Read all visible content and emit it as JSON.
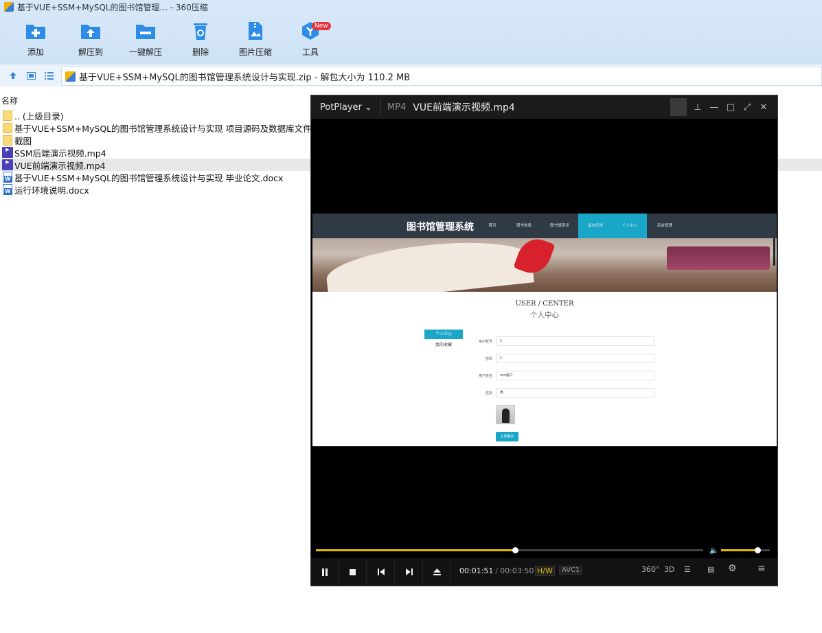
{
  "window": {
    "title": "基于VUE+SSM+MySQL的图书馆管理... - 360压缩"
  },
  "toolbar": {
    "add": "添加",
    "extract_to": "解压到",
    "one_click_extract": "一键解压",
    "delete": "删除",
    "image_compress": "图片压缩",
    "tools": "工具",
    "new_badge": "New"
  },
  "address": {
    "path": "基于VUE+SSM+MySQL的图书馆管理系统设计与实现.zip - 解包大小为 110.2 MB"
  },
  "filelist": {
    "column_name": "名称",
    "items": [
      {
        "name": ".. (上级目录)",
        "type": "folder"
      },
      {
        "name": "基于VUE+SSM+MySQL的图书馆管理系统设计与实现 项目源码及数据库文件",
        "type": "folder"
      },
      {
        "name": "截图",
        "type": "folder"
      },
      {
        "name": "SSM后端演示视频.mp4",
        "type": "mp4"
      },
      {
        "name": "VUE前端演示视频.mp4",
        "type": "mp4",
        "selected": true
      },
      {
        "name": "基于VUE+SSM+MySQL的图书馆管理系统设计与实现 毕业论文.docx",
        "type": "docx"
      },
      {
        "name": "运行环境说明.docx",
        "type": "docx"
      }
    ]
  },
  "player": {
    "brand": "PotPlayer",
    "format": "MP4",
    "filename": "VUE前端演示视频.mp4",
    "current_time": "00:01:51",
    "duration": "00:03:50",
    "hw": "H/W",
    "codec": "AVC1",
    "progress_fraction": 0.515,
    "volume_fraction": 0.75,
    "btn_360": "360°",
    "btn_3d": "3D"
  },
  "video": {
    "logo": "图书馆管理系统",
    "nav": [
      "首页",
      "图书信息",
      "图书馆资讯",
      "留言反馈",
      "个人中心",
      "后台管理"
    ],
    "heading_en": "USER / CENTER",
    "heading_cn": "个人中心",
    "side_active": "个人中心",
    "side_item": "我的收藏",
    "form": [
      {
        "label": "用户账号",
        "value": "1"
      },
      {
        "label": "密码",
        "value": "1"
      },
      {
        "label": "用户姓名",
        "value": "xxx用户"
      },
      {
        "label": "性别",
        "value": "男"
      }
    ],
    "upload": "上传图片"
  },
  "colors": {
    "accent": "#1aa6c7",
    "player_progress": "#e5c100",
    "toolbar_bg": "#d6e7f8"
  }
}
